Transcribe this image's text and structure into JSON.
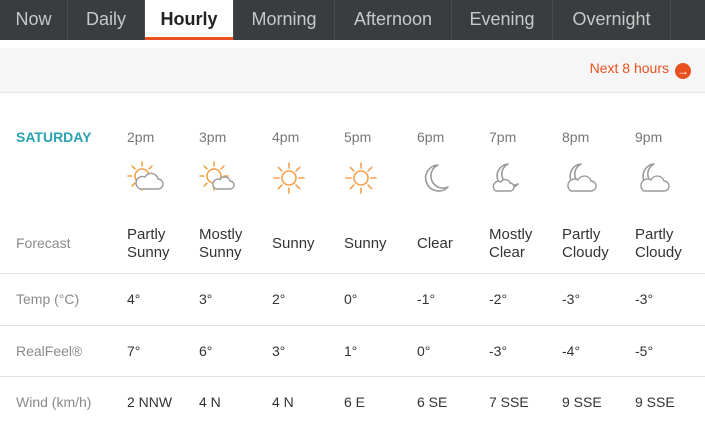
{
  "tabs": [
    "Now",
    "Daily",
    "Hourly",
    "Morning",
    "Afternoon",
    "Evening",
    "Overnight"
  ],
  "active_tab": "Hourly",
  "next_link": {
    "label": "Next 8 hours",
    "arrow": "→"
  },
  "day": "SATURDAY",
  "hours": [
    "2pm",
    "3pm",
    "4pm",
    "5pm",
    "6pm",
    "7pm",
    "8pm",
    "9pm"
  ],
  "icons": [
    "partly-sunny-icon",
    "mostly-sunny-icon",
    "sunny-icon",
    "sunny-icon",
    "moon-icon",
    "mostly-clear-night-icon",
    "partly-cloudy-night-icon",
    "partly-cloudy-night-icon"
  ],
  "labels": {
    "forecast": "Forecast",
    "temp": "Temp (°C)",
    "realfeel": "RealFeel®",
    "wind": "Wind (km/h)"
  },
  "forecast": [
    [
      "Partly",
      "Sunny"
    ],
    [
      "Mostly",
      "Sunny"
    ],
    [
      "Sunny"
    ],
    [
      "Sunny"
    ],
    [
      "Clear"
    ],
    [
      "Mostly",
      "Clear"
    ],
    [
      "Partly",
      "Cloudy"
    ],
    [
      "Partly",
      "Cloudy"
    ]
  ],
  "temp": [
    "4°",
    "3°",
    "2°",
    "0°",
    "-1°",
    "-2°",
    "-3°",
    "-3°"
  ],
  "realfeel": [
    "7°",
    "6°",
    "3°",
    "1°",
    "0°",
    "-3°",
    "-4°",
    "-5°"
  ],
  "wind": [
    "2 NNW",
    "4 N",
    "4 N",
    "6 E",
    "6 SE",
    "7 SSE",
    "9 SSE",
    "9 SSE"
  ],
  "colors": {
    "accent": "#e8511f",
    "day": "#2aa1b3",
    "sun": "#f5a04a",
    "moon": "#9a9a9a"
  }
}
